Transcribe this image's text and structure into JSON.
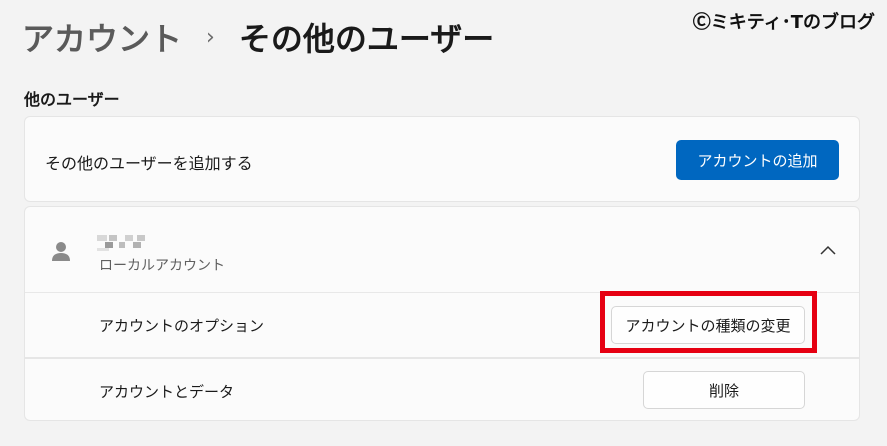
{
  "watermark": "Ⓒミキティ･Tのブログ",
  "breadcrumb": {
    "parent": "アカウント",
    "separator": "›",
    "current": "その他のユーザー"
  },
  "section_title": "他のユーザー",
  "add_user": {
    "label": "その他のユーザーを追加する",
    "button_label": "アカウントの追加"
  },
  "user": {
    "name_obscured": true,
    "subtitle": "ローカルアカウント",
    "options_label": "アカウントのオプション",
    "change_type_button": "アカウントの種類の変更",
    "data_label": "アカウントとデータ",
    "delete_button": "削除"
  },
  "colors": {
    "accent": "#0067c0",
    "highlight": "#e60012",
    "background": "#f3f3f3"
  },
  "icons": {
    "avatar": "person-icon",
    "expand": "chevron-up-icon"
  }
}
